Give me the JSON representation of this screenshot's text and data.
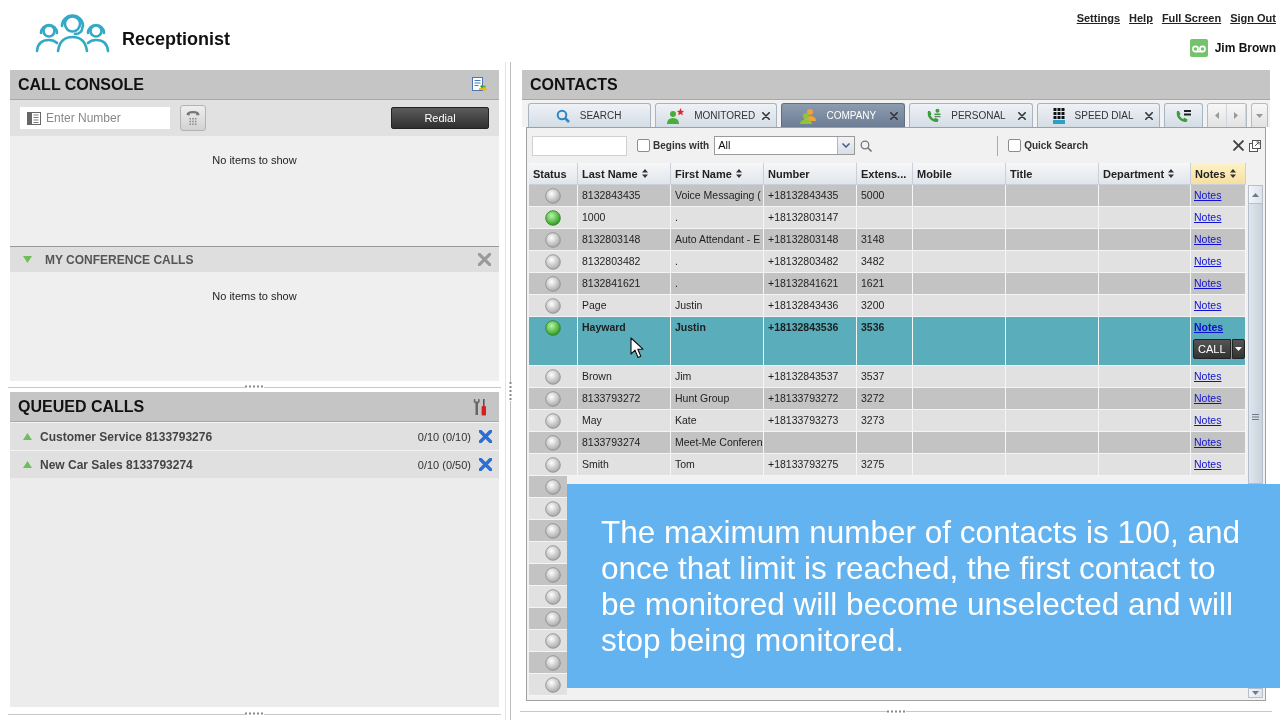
{
  "header": {
    "app_title": "Receptionist",
    "links": [
      "Settings",
      "Help",
      "Full Screen",
      "Sign Out"
    ],
    "user_name": "Jim Brown"
  },
  "call_console": {
    "title": "CALL CONSOLE",
    "number_field": {
      "placeholder": "Enter Number"
    },
    "redial_button": "Redial",
    "empty_message": "No items to show",
    "conference": {
      "title": "MY CONFERENCE CALLS",
      "expanded": true,
      "empty_message": "No items to show"
    }
  },
  "queued_calls": {
    "title": "QUEUED CALLS",
    "queues": [
      {
        "name": "Customer Service 8133793276",
        "counts": "0/10 (0/10)",
        "expanded": false
      },
      {
        "name": "New Car Sales 8133793274",
        "counts": "0/10 (0/50)",
        "expanded": false
      }
    ]
  },
  "contacts": {
    "title": "CONTACTS",
    "tabs": [
      {
        "kind": "search",
        "label": "SEARCH",
        "selected": false,
        "closable": false
      },
      {
        "kind": "monitored",
        "label": "MONITORED",
        "selected": false,
        "closable": true
      },
      {
        "kind": "company",
        "label": "COMPANY",
        "selected": true,
        "closable": true
      },
      {
        "kind": "personal",
        "label": "PERSONAL",
        "selected": false,
        "closable": true
      },
      {
        "kind": "speed_dial",
        "label": "SPEED DIAL",
        "selected": false,
        "closable": true
      },
      {
        "kind": "queue",
        "selected": false,
        "closable": false
      }
    ],
    "filter": {
      "begins_with": {
        "label": "Begins with",
        "checked": false
      },
      "match": "All",
      "quick_search": {
        "label": "Quick Search",
        "checked": false
      }
    },
    "table": {
      "columns": [
        {
          "label": "Status",
          "sortable": false,
          "highlighted": false
        },
        {
          "label": "Last Name",
          "sortable": true,
          "highlighted": false
        },
        {
          "label": "First Name",
          "sortable": true,
          "highlighted": false
        },
        {
          "label": "Number",
          "sortable": false,
          "highlighted": false
        },
        {
          "label": "Extens...",
          "sortable": false,
          "highlighted": false
        },
        {
          "label": "Mobile",
          "sortable": false,
          "highlighted": false
        },
        {
          "label": "Title",
          "sortable": false,
          "highlighted": false
        },
        {
          "label": "Department",
          "sortable": true,
          "highlighted": false
        },
        {
          "label": "Notes",
          "sortable": true,
          "highlighted": true
        }
      ],
      "rows": [
        {
          "online": false,
          "selected": false,
          "last_name": "8132843435",
          "first_name": "Voice Messaging (",
          "number": "+18132843435",
          "extension": "5000",
          "notes": "Notes"
        },
        {
          "online": true,
          "selected": false,
          "last_name": "1000",
          "first_name": ".",
          "number": "+18132803147",
          "notes": "Notes"
        },
        {
          "online": false,
          "selected": false,
          "last_name": "8132803148",
          "first_name": "Auto Attendant - E",
          "number": "+18132803148",
          "extension": "3148",
          "notes": "Notes"
        },
        {
          "online": false,
          "selected": false,
          "last_name": "8132803482",
          "first_name": ".",
          "number": "+18132803482",
          "extension": "3482",
          "notes": "Notes"
        },
        {
          "online": false,
          "selected": false,
          "last_name": "8132841621",
          "first_name": ".",
          "number": "+18132841621",
          "extension": "1621",
          "notes": "Notes"
        },
        {
          "online": false,
          "selected": false,
          "last_name": "Page",
          "first_name": "Justin",
          "number": "+18132843436",
          "extension": "3200",
          "notes": "Notes"
        },
        {
          "online": true,
          "selected": true,
          "last_name": "Hayward",
          "first_name": "Justin",
          "number": "+18132843536",
          "extension": "3536",
          "notes": "Notes",
          "action": "CALL"
        },
        {
          "online": false,
          "selected": false,
          "last_name": "Brown",
          "first_name": "Jim",
          "number": "+18132843537",
          "extension": "3537",
          "notes": "Notes"
        },
        {
          "online": false,
          "selected": false,
          "last_name": "8133793272",
          "first_name": "Hunt Group",
          "number": "+18133793272",
          "extension": "3272",
          "notes": "Notes"
        },
        {
          "online": false,
          "selected": false,
          "last_name": "May",
          "first_name": "Kate",
          "number": "+18133793273",
          "extension": "3273",
          "notes": "Notes"
        },
        {
          "online": false,
          "selected": false,
          "last_name": "8133793274",
          "first_name": "Meet-Me Conferen",
          "notes": "Notes"
        },
        {
          "online": false,
          "selected": false,
          "last_name": "Smith",
          "first_name": "Tom",
          "number": "+18133793275",
          "extension": "3275",
          "notes": "Notes"
        },
        {
          "online": false,
          "selected": false
        },
        {
          "online": false,
          "selected": false
        },
        {
          "online": false,
          "selected": false
        },
        {
          "online": false,
          "selected": false
        },
        {
          "online": false,
          "selected": false
        },
        {
          "online": false,
          "selected": false
        },
        {
          "online": false,
          "selected": false
        },
        {
          "online": false,
          "selected": false
        },
        {
          "online": false,
          "selected": false
        },
        {
          "online": false,
          "selected": false
        }
      ]
    }
  },
  "caption": {
    "text": "The maximum number of contacts is 100, and once that limit is reached, the first contact to be monitored will become unselected and will stop being monitored."
  }
}
